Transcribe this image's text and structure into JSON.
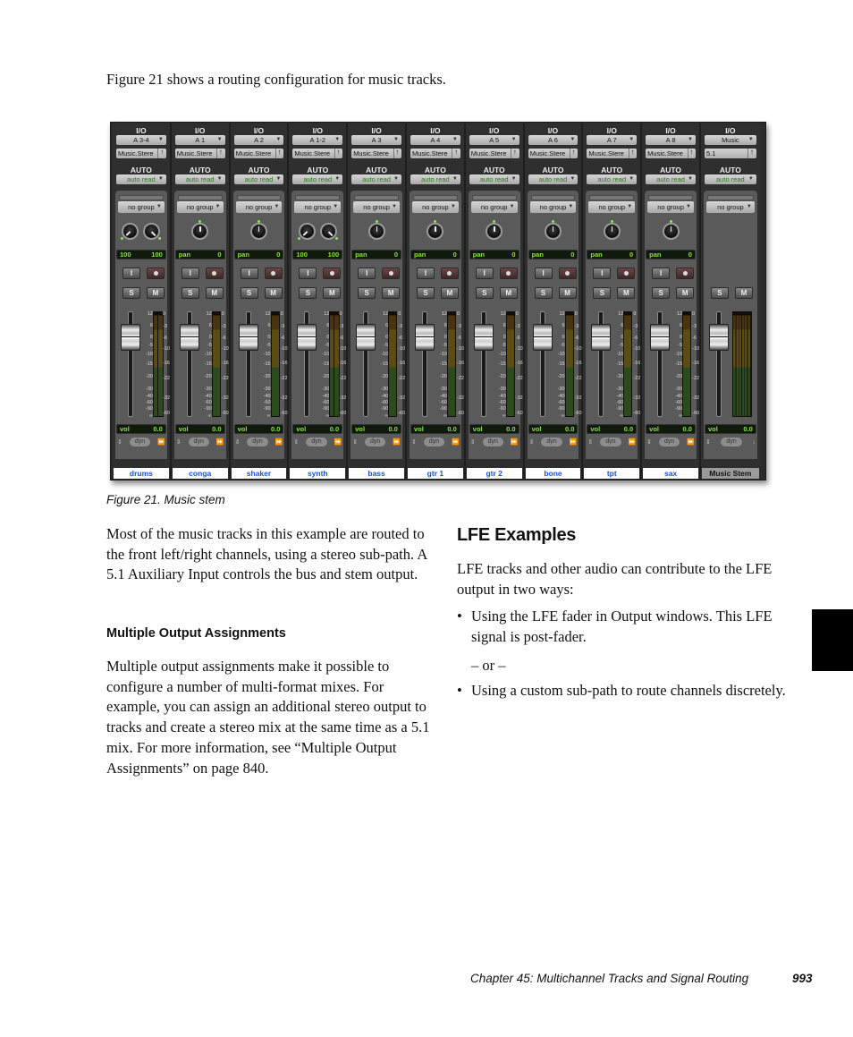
{
  "intro": "Figure 21 shows a routing configuration for music tracks.",
  "mixer": {
    "io_label": "I/O",
    "auto_label": "AUTO",
    "fader_scale": [
      "12",
      "6",
      "0",
      "-5",
      "-10",
      "-15",
      "-20",
      "-30",
      "-40",
      "-60",
      "-90",
      "∞"
    ],
    "meter_scale": [
      "0",
      "-3",
      "-6",
      "-10",
      "-16",
      "-22",
      "-32",
      "-60"
    ],
    "channels": [
      {
        "name": "drums",
        "output": "A 3-4",
        "subpath": "Music.Stere",
        "automation": "auto read",
        "group": "no group",
        "pan_type": "stereo",
        "pan_left": "100",
        "pan_right": "100",
        "vol_label": "vol",
        "vol": "0.0",
        "dyn": "dyn",
        "type": "audio"
      },
      {
        "name": "conga",
        "output": "A 1",
        "subpath": "Music.Stere",
        "automation": "auto read",
        "group": "no group",
        "pan_type": "mono",
        "pan_label": "pan",
        "pan_value": "0",
        "vol_label": "vol",
        "vol": "0.0",
        "dyn": "dyn",
        "type": "audio"
      },
      {
        "name": "shaker",
        "output": "A 2",
        "subpath": "Music.Stere",
        "automation": "auto read",
        "group": "no group",
        "pan_type": "mono",
        "pan_label": "pan",
        "pan_value": "0",
        "vol_label": "vol",
        "vol": "0.0",
        "dyn": "dyn",
        "type": "audio"
      },
      {
        "name": "synth",
        "output": "A 1-2",
        "subpath": "Music.Stere",
        "automation": "auto read",
        "group": "no group",
        "pan_type": "stereo",
        "pan_left": "100",
        "pan_right": "100",
        "vol_label": "vol",
        "vol": "0.0",
        "dyn": "dyn",
        "type": "audio"
      },
      {
        "name": "bass",
        "output": "A 3",
        "subpath": "Music.Stere",
        "automation": "auto read",
        "group": "no group",
        "pan_type": "mono",
        "pan_label": "pan",
        "pan_value": "0",
        "vol_label": "vol",
        "vol": "0.0",
        "dyn": "dyn",
        "type": "audio"
      },
      {
        "name": "gtr 1",
        "output": "A 4",
        "subpath": "Music.Stere",
        "automation": "auto read",
        "group": "no group",
        "pan_type": "mono",
        "pan_label": "pan",
        "pan_value": "0",
        "vol_label": "vol",
        "vol": "0.0",
        "dyn": "dyn",
        "type": "audio"
      },
      {
        "name": "gtr 2",
        "output": "A 5",
        "subpath": "Music.Stere",
        "automation": "auto read",
        "group": "no group",
        "pan_type": "mono",
        "pan_label": "pan",
        "pan_value": "0",
        "vol_label": "vol",
        "vol": "0.0",
        "dyn": "dyn",
        "type": "audio"
      },
      {
        "name": "bone",
        "output": "A 6",
        "subpath": "Music.Stere",
        "automation": "auto read",
        "group": "no group",
        "pan_type": "mono",
        "pan_label": "pan",
        "pan_value": "0",
        "vol_label": "vol",
        "vol": "0.0",
        "dyn": "dyn",
        "type": "audio"
      },
      {
        "name": "tpt",
        "output": "A 7",
        "subpath": "Music.Stere",
        "automation": "auto read",
        "group": "no group",
        "pan_type": "mono",
        "pan_label": "pan",
        "pan_value": "0",
        "vol_label": "vol",
        "vol": "0.0",
        "dyn": "dyn",
        "type": "audio"
      },
      {
        "name": "sax",
        "output": "A 8",
        "subpath": "Music.Stere",
        "automation": "auto read",
        "group": "no group",
        "pan_type": "mono",
        "pan_label": "pan",
        "pan_value": "0",
        "vol_label": "vol",
        "vol": "0.0",
        "dyn": "dyn",
        "type": "audio"
      },
      {
        "name": "Music Stem",
        "output": "Music",
        "subpath": "5.1",
        "automation": "auto read",
        "group": "no group",
        "pan_type": "none",
        "vol_label": "vol",
        "vol": "0.0",
        "dyn": "dyn",
        "type": "aux"
      }
    ],
    "button_labels": {
      "input": "I",
      "solo": "S",
      "mute": "M"
    }
  },
  "caption": "Figure 21.  Music stem",
  "left_col": {
    "p1": "Most of the music tracks in this example are routed to the front left/right channels, using a stereo sub-path. A 5.1 Auxiliary Input controls the bus and stem output.",
    "heading": "Multiple Output Assignments",
    "p2": "Multiple output assignments make it possible to configure a number of multi-format mixes. For example, you can assign an additional stereo output to tracks and create a stereo mix at the same time as a 5.1 mix. For more information, see “Multiple Output Assignments” on page 840."
  },
  "right_col": {
    "heading": "LFE Examples",
    "p1": "LFE tracks and other audio can contribute to the LFE output in two ways:",
    "bullet_char": "•",
    "bullet1": "Using the LFE fader in Output windows. This LFE signal is post-fader.",
    "or": "– or –",
    "bullet2": "Using a custom sub-path to route channels discretely."
  },
  "footer": {
    "chapter": "Chapter 45: Multichannel Tracks and Signal Routing",
    "page": "993"
  }
}
